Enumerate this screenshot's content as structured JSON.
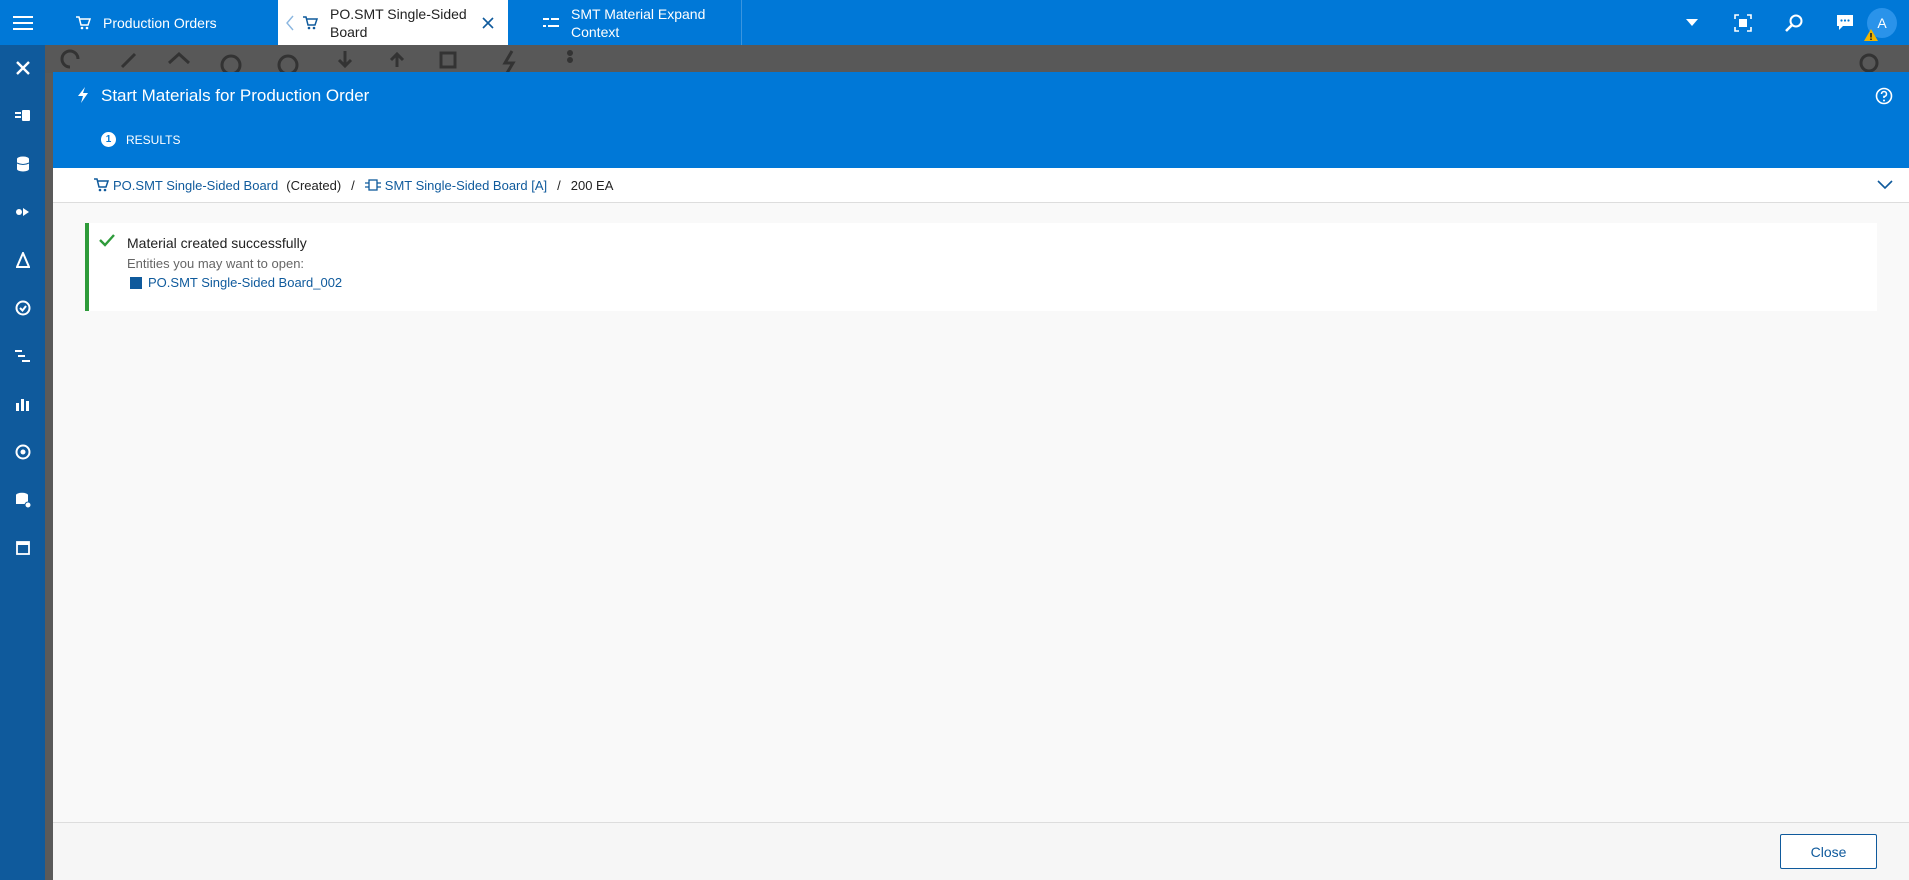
{
  "tabs": [
    {
      "label": "Production Orders",
      "icon": "cart-icon"
    },
    {
      "label": "PO.SMT Single-Sided Board",
      "icon": "cart-icon"
    },
    {
      "label": "SMT Material Expand Context",
      "icon": "material-expand-icon"
    }
  ],
  "user": {
    "avatar_initial": "A"
  },
  "modal": {
    "title": "Start Materials for Production Order",
    "step": {
      "number": "1",
      "label": "RESULTS"
    },
    "breadcrumb": {
      "order_link": "PO.SMT Single-Sided Board",
      "order_status": "(Created)",
      "product_link": "SMT Single-Sided Board [A]",
      "quantity": "200 EA",
      "separator": "/"
    },
    "result": {
      "title": "Material created successfully",
      "subtitle": "Entities you may want to open:",
      "entity_link": "PO.SMT Single-Sided Board_002"
    },
    "close_label": "Close"
  },
  "colors": {
    "primary": "#0078d7",
    "sidebar": "#0f5a9c",
    "success": "#2e9b3a",
    "link": "#0f5a9c"
  }
}
